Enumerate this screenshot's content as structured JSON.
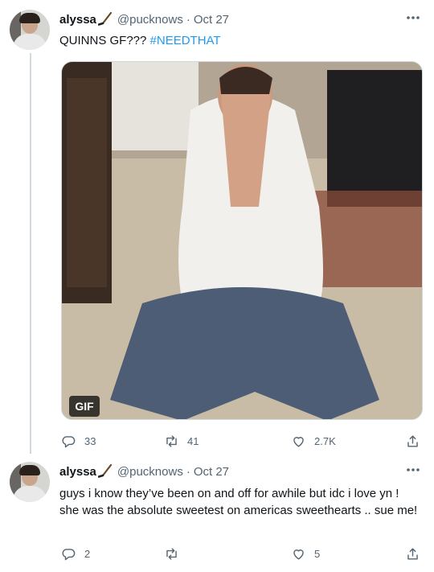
{
  "tweets": [
    {
      "display_name": "alyssa",
      "handle": "@pucknows",
      "separator": "·",
      "date": "Oct 27",
      "text_plain": "QUINNS GF??? ",
      "hashtag": "#NEEDTHAT",
      "media": {
        "badge": "GIF"
      },
      "actions": {
        "replies": "33",
        "retweets": "41",
        "likes": "2.7K"
      }
    },
    {
      "display_name": "alyssa",
      "handle": "@pucknows",
      "separator": "·",
      "date": "Oct 27",
      "text": "guys i know they’ve been on and off for awhile but idc i love yn ! she was the absolute sweetest on americas sweethearts .. sue me!",
      "actions": {
        "replies": "2",
        "retweets": "",
        "likes": "5"
      }
    }
  ],
  "icons": [
    "hockey-stick-icon",
    "more-icon",
    "reply-icon",
    "retweet-icon",
    "like-icon",
    "share-icon"
  ],
  "colors": {
    "link": "#1d9bf0",
    "meta": "#536471",
    "text": "#0f1419",
    "thread_line": "#cfd9de"
  }
}
